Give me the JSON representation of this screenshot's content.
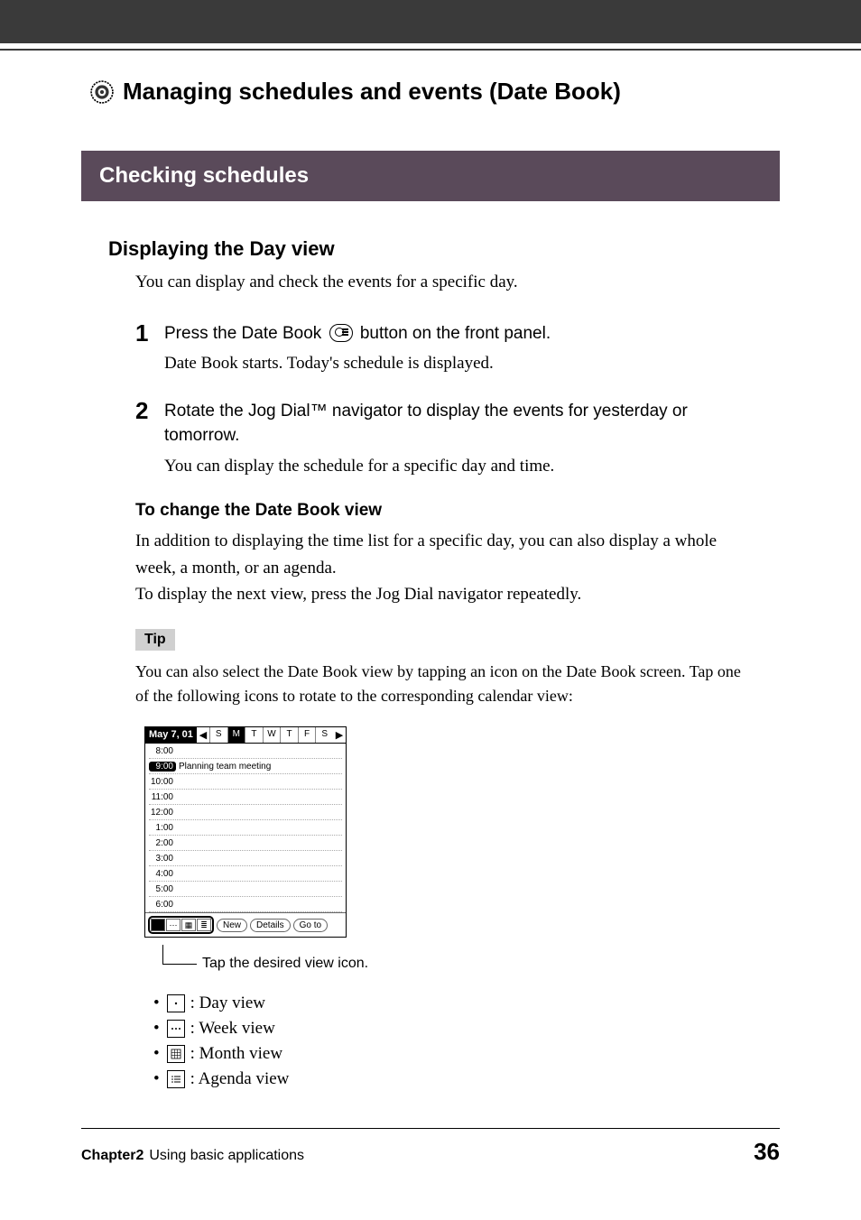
{
  "chapter": {
    "title": "Managing schedules and events (Date Book)"
  },
  "section": {
    "title": "Checking schedules"
  },
  "subsection": {
    "title": "Displaying the Day view",
    "intro": "You can display and check the events for a specific day."
  },
  "steps": [
    {
      "num": "1",
      "title_before": "Press the Date Book ",
      "title_after": " button on the front panel.",
      "desc": "Date Book starts. Today's schedule is displayed."
    },
    {
      "num": "2",
      "title": "Rotate the Jog Dial™ navigator to display the events for yesterday or tomorrow.",
      "desc": "You can display the schedule for a specific day and time."
    }
  ],
  "change_view": {
    "heading": "To change the Date Book view",
    "p1": "In addition to displaying the time list for a specific day, you can also display a whole week, a month, or an agenda.",
    "p2": "To display the next view, press the Jog Dial navigator repeatedly."
  },
  "tip": {
    "label": "Tip",
    "text": "You can also select the Date Book view by tapping an icon on the Date Book screen. Tap one of the following icons to rotate to the corresponding calendar view:"
  },
  "screenshot": {
    "date": "May 7, 01",
    "days": [
      "S",
      "M",
      "T",
      "W",
      "T",
      "F",
      "S"
    ],
    "active_day_index": 1,
    "rows": [
      {
        "time": "8:00",
        "event": ""
      },
      {
        "time": "9:00",
        "event": "Planning team meeting",
        "active": true
      },
      {
        "time": "10:00",
        "event": ""
      },
      {
        "time": "11:00",
        "event": ""
      },
      {
        "time": "12:00",
        "event": ""
      },
      {
        "time": "1:00",
        "event": ""
      },
      {
        "time": "2:00",
        "event": ""
      },
      {
        "time": "3:00",
        "event": ""
      },
      {
        "time": "4:00",
        "event": ""
      },
      {
        "time": "5:00",
        "event": ""
      },
      {
        "time": "6:00",
        "event": ""
      }
    ],
    "buttons": [
      "New",
      "Details",
      "Go to"
    ],
    "callout": "Tap the desired view icon."
  },
  "view_icons": [
    {
      "label": ": Day view",
      "type": "day"
    },
    {
      "label": ": Week view",
      "type": "week"
    },
    {
      "label": ": Month view",
      "type": "month"
    },
    {
      "label": ": Agenda view",
      "type": "agenda"
    }
  ],
  "footer": {
    "chapter": "Chapter2",
    "title": "Using basic applications",
    "page": "36"
  }
}
